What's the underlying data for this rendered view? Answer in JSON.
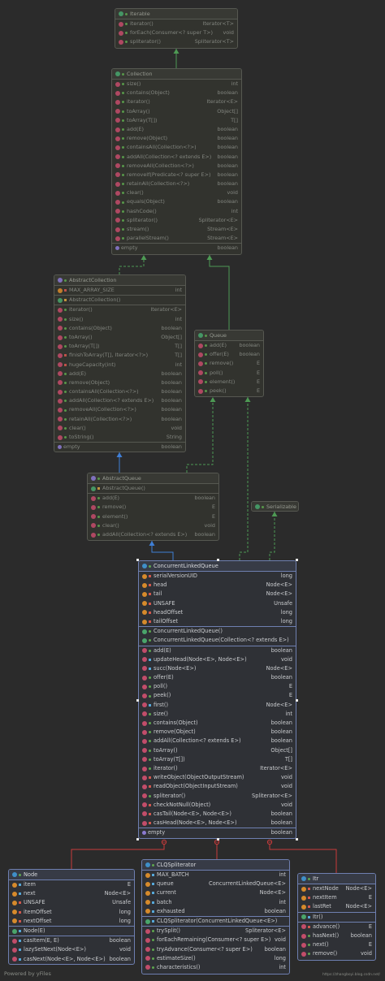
{
  "classes": [
    {
      "id": "Iterable",
      "kind": "interface",
      "title": "Iterable",
      "sections": [
        [
          {
            "icon": "m",
            "vis": "pub",
            "name": "iterator()",
            "type": "Iterator<T>"
          },
          {
            "icon": "m",
            "vis": "pub",
            "name": "forEach(Consumer<? super T>)",
            "type": "void"
          },
          {
            "icon": "m",
            "vis": "pub",
            "name": "spliterator()",
            "type": "Spliterator<T>"
          }
        ]
      ]
    },
    {
      "id": "Collection",
      "kind": "interface",
      "title": "Collection",
      "sections": [
        [
          {
            "icon": "m",
            "vis": "pub",
            "name": "size()",
            "type": "int"
          },
          {
            "icon": "m",
            "vis": "pub",
            "name": "contains(Object)",
            "type": "boolean"
          },
          {
            "icon": "m",
            "vis": "pub",
            "name": "iterator()",
            "type": "Iterator<E>"
          },
          {
            "icon": "m",
            "vis": "pub",
            "name": "toArray()",
            "type": "Object[]"
          },
          {
            "icon": "m",
            "vis": "pub",
            "name": "toArray(T[])",
            "type": "T[]"
          },
          {
            "icon": "m",
            "vis": "pub",
            "name": "add(E)",
            "type": "boolean"
          },
          {
            "icon": "m",
            "vis": "pub",
            "name": "remove(Object)",
            "type": "boolean"
          },
          {
            "icon": "m",
            "vis": "pub",
            "name": "containsAll(Collection<?>)",
            "type": "boolean"
          },
          {
            "icon": "m",
            "vis": "pub",
            "name": "addAll(Collection<? extends E>)",
            "type": "boolean"
          },
          {
            "icon": "m",
            "vis": "pub",
            "name": "removeAll(Collection<?>)",
            "type": "boolean"
          },
          {
            "icon": "m",
            "vis": "pub",
            "name": "removeIf(Predicate<? super E>)",
            "type": "boolean"
          },
          {
            "icon": "m",
            "vis": "pub",
            "name": "retainAll(Collection<?>)",
            "type": "boolean"
          },
          {
            "icon": "m",
            "vis": "pub",
            "name": "clear()",
            "type": "void"
          },
          {
            "icon": "m",
            "vis": "pub",
            "name": "equals(Object)",
            "type": "boolean"
          },
          {
            "icon": "m",
            "vis": "pub",
            "name": "hashCode()",
            "type": "int"
          },
          {
            "icon": "m",
            "vis": "pub",
            "name": "spliterator()",
            "type": "Spliterator<E>"
          },
          {
            "icon": "m",
            "vis": "pub",
            "name": "stream()",
            "type": "Stream<E>"
          },
          {
            "icon": "m",
            "vis": "pub",
            "name": "parallelStream()",
            "type": "Stream<E>"
          }
        ],
        [
          {
            "icon": "p",
            "vis": "",
            "name": "empty",
            "type": "boolean"
          }
        ]
      ]
    },
    {
      "id": "AbstractCollection",
      "kind": "abstract",
      "title": "AbstractCollection",
      "sections": [
        [
          {
            "icon": "f",
            "vis": "pri",
            "name": "MAX_ARRAY_SIZE",
            "type": "int"
          }
        ],
        [
          {
            "icon": "c",
            "vis": "pro",
            "name": "AbstractCollection()",
            "type": ""
          }
        ],
        [
          {
            "icon": "m",
            "vis": "pub",
            "name": "iterator()",
            "type": "Iterator<E>"
          },
          {
            "icon": "m",
            "vis": "pub",
            "name": "size()",
            "type": "int"
          },
          {
            "icon": "m",
            "vis": "pub",
            "name": "contains(Object)",
            "type": "boolean"
          },
          {
            "icon": "m",
            "vis": "pub",
            "name": "toArray()",
            "type": "Object[]"
          },
          {
            "icon": "m",
            "vis": "pub",
            "name": "toArray(T[])",
            "type": "T[]"
          },
          {
            "icon": "m",
            "vis": "pri",
            "name": "finishToArray(T[], Iterator<?>)",
            "type": "T[]"
          },
          {
            "icon": "m",
            "vis": "pri",
            "name": "hugeCapacity(int)",
            "type": "int"
          },
          {
            "icon": "m",
            "vis": "pub",
            "name": "add(E)",
            "type": "boolean"
          },
          {
            "icon": "m",
            "vis": "pub",
            "name": "remove(Object)",
            "type": "boolean"
          },
          {
            "icon": "m",
            "vis": "pub",
            "name": "containsAll(Collection<?>)",
            "type": "boolean"
          },
          {
            "icon": "m",
            "vis": "pub",
            "name": "addAll(Collection<? extends E>)",
            "type": "boolean"
          },
          {
            "icon": "m",
            "vis": "pub",
            "name": "removeAll(Collection<?>)",
            "type": "boolean"
          },
          {
            "icon": "m",
            "vis": "pub",
            "name": "retainAll(Collection<?>)",
            "type": "boolean"
          },
          {
            "icon": "m",
            "vis": "pub",
            "name": "clear()",
            "type": "void"
          },
          {
            "icon": "m",
            "vis": "pub",
            "name": "toString()",
            "type": "String"
          }
        ],
        [
          {
            "icon": "p",
            "vis": "",
            "name": "empty",
            "type": "boolean"
          }
        ]
      ]
    },
    {
      "id": "Queue",
      "kind": "interface",
      "title": "Queue",
      "sections": [
        [
          {
            "icon": "m",
            "vis": "pub",
            "name": "add(E)",
            "type": "boolean"
          },
          {
            "icon": "m",
            "vis": "pub",
            "name": "offer(E)",
            "type": "boolean"
          },
          {
            "icon": "m",
            "vis": "pub",
            "name": "remove()",
            "type": "E"
          },
          {
            "icon": "m",
            "vis": "pub",
            "name": "poll()",
            "type": "E"
          },
          {
            "icon": "m",
            "vis": "pub",
            "name": "element()",
            "type": "E"
          },
          {
            "icon": "m",
            "vis": "pub",
            "name": "peek()",
            "type": "E"
          }
        ]
      ]
    },
    {
      "id": "AbstractQueue",
      "kind": "abstract",
      "title": "AbstractQueue",
      "sections": [
        [
          {
            "icon": "c",
            "vis": "pro",
            "name": "AbstractQueue()",
            "type": ""
          }
        ],
        [
          {
            "icon": "m",
            "vis": "pub",
            "name": "add(E)",
            "type": "boolean"
          },
          {
            "icon": "m",
            "vis": "pub",
            "name": "remove()",
            "type": "E"
          },
          {
            "icon": "m",
            "vis": "pub",
            "name": "element()",
            "type": "E"
          },
          {
            "icon": "m",
            "vis": "pub",
            "name": "clear()",
            "type": "void"
          },
          {
            "icon": "m",
            "vis": "pub",
            "name": "addAll(Collection<? extends E>)",
            "type": "boolean"
          }
        ]
      ]
    },
    {
      "id": "Serializable",
      "kind": "interface",
      "title": "Serializable",
      "sections": []
    },
    {
      "id": "ConcurrentLinkedQueue",
      "kind": "class",
      "title": "ConcurrentLinkedQueue",
      "sections": [
        [
          {
            "icon": "f",
            "vis": "pri",
            "name": "serialVersionUID",
            "type": "long"
          },
          {
            "icon": "f",
            "vis": "pri",
            "name": "head",
            "type": "Node<E>"
          },
          {
            "icon": "f",
            "vis": "pri",
            "name": "tail",
            "type": "Node<E>"
          },
          {
            "icon": "f",
            "vis": "pri",
            "name": "UNSAFE",
            "type": "Unsafe"
          },
          {
            "icon": "f",
            "vis": "pri",
            "name": "headOffset",
            "type": "long"
          },
          {
            "icon": "f",
            "vis": "pri",
            "name": "tailOffset",
            "type": "long"
          }
        ],
        [
          {
            "icon": "c",
            "vis": "pub",
            "name": "ConcurrentLinkedQueue()",
            "type": ""
          },
          {
            "icon": "c",
            "vis": "pub",
            "name": "ConcurrentLinkedQueue(Collection<? extends E>)",
            "type": ""
          }
        ],
        [
          {
            "icon": "m",
            "vis": "pub",
            "name": "add(E)",
            "type": "boolean"
          },
          {
            "icon": "m",
            "vis": "pkg",
            "name": "updateHead(Node<E>, Node<E>)",
            "type": "void"
          },
          {
            "icon": "m",
            "vis": "pkg",
            "name": "succ(Node<E>)",
            "type": "Node<E>"
          },
          {
            "icon": "m",
            "vis": "pub",
            "name": "offer(E)",
            "type": "boolean"
          },
          {
            "icon": "m",
            "vis": "pub",
            "name": "poll()",
            "type": "E"
          },
          {
            "icon": "m",
            "vis": "pub",
            "name": "peek()",
            "type": "E"
          },
          {
            "icon": "m",
            "vis": "pkg",
            "name": "first()",
            "type": "Node<E>"
          },
          {
            "icon": "m",
            "vis": "pub",
            "name": "size()",
            "type": "int"
          },
          {
            "icon": "m",
            "vis": "pub",
            "name": "contains(Object)",
            "type": "boolean"
          },
          {
            "icon": "m",
            "vis": "pub",
            "name": "remove(Object)",
            "type": "boolean"
          },
          {
            "icon": "m",
            "vis": "pub",
            "name": "addAll(Collection<? extends E>)",
            "type": "boolean"
          },
          {
            "icon": "m",
            "vis": "pub",
            "name": "toArray()",
            "type": "Object[]"
          },
          {
            "icon": "m",
            "vis": "pub",
            "name": "toArray(T[])",
            "type": "T[]"
          },
          {
            "icon": "m",
            "vis": "pub",
            "name": "iterator()",
            "type": "Iterator<E>"
          },
          {
            "icon": "m",
            "vis": "pri",
            "name": "writeObject(ObjectOutputStream)",
            "type": "void"
          },
          {
            "icon": "m",
            "vis": "pri",
            "name": "readObject(ObjectInputStream)",
            "type": "void"
          },
          {
            "icon": "m",
            "vis": "pub",
            "name": "spliterator()",
            "type": "Spliterator<E>"
          },
          {
            "icon": "m",
            "vis": "pri",
            "name": "checkNotNull(Object)",
            "type": "void"
          },
          {
            "icon": "m",
            "vis": "pri",
            "name": "casTail(Node<E>, Node<E>)",
            "type": "boolean"
          },
          {
            "icon": "m",
            "vis": "pri",
            "name": "casHead(Node<E>, Node<E>)",
            "type": "boolean"
          }
        ],
        [
          {
            "icon": "p",
            "vis": "",
            "name": "empty",
            "type": "boolean"
          }
        ]
      ]
    },
    {
      "id": "Node",
      "kind": "class",
      "title": "Node",
      "sections": [
        [
          {
            "icon": "f",
            "vis": "pkg",
            "name": "item",
            "type": "E"
          },
          {
            "icon": "f",
            "vis": "pkg",
            "name": "next",
            "type": "Node<E>"
          },
          {
            "icon": "f",
            "vis": "pri",
            "name": "UNSAFE",
            "type": "Unsafe"
          },
          {
            "icon": "f",
            "vis": "pri",
            "name": "itemOffset",
            "type": "long"
          },
          {
            "icon": "f",
            "vis": "pri",
            "name": "nextOffset",
            "type": "long"
          }
        ],
        [
          {
            "icon": "c",
            "vis": "pkg",
            "name": "Node(E)",
            "type": ""
          }
        ],
        [
          {
            "icon": "m",
            "vis": "pkg",
            "name": "casItem(E, E)",
            "type": "boolean"
          },
          {
            "icon": "m",
            "vis": "pkg",
            "name": "lazySetNext(Node<E>)",
            "type": "void"
          },
          {
            "icon": "m",
            "vis": "pkg",
            "name": "casNext(Node<E>, Node<E>)",
            "type": "boolean"
          }
        ]
      ]
    },
    {
      "id": "CLQSpliterator",
      "kind": "class",
      "title": "CLQSpliterator",
      "sections": [
        [
          {
            "icon": "f",
            "vis": "pkg",
            "name": "MAX_BATCH",
            "type": "int"
          },
          {
            "icon": "f",
            "vis": "pkg",
            "name": "queue",
            "type": "ConcurrentLinkedQueue<E>"
          },
          {
            "icon": "f",
            "vis": "pkg",
            "name": "current",
            "type": "Node<E>"
          },
          {
            "icon": "f",
            "vis": "pkg",
            "name": "batch",
            "type": "int"
          },
          {
            "icon": "f",
            "vis": "pkg",
            "name": "exhausted",
            "type": "boolean"
          }
        ],
        [
          {
            "icon": "c",
            "vis": "pkg",
            "name": "CLQSpliterator(ConcurrentLinkedQueue<E>)",
            "type": ""
          }
        ],
        [
          {
            "icon": "m",
            "vis": "pub",
            "name": "trySplit()",
            "type": "Spliterator<E>"
          },
          {
            "icon": "m",
            "vis": "pub",
            "name": "forEachRemaining(Consumer<? super E>)",
            "type": "void"
          },
          {
            "icon": "m",
            "vis": "pub",
            "name": "tryAdvance(Consumer<? super E>)",
            "type": "boolean"
          },
          {
            "icon": "m",
            "vis": "pub",
            "name": "estimateSize()",
            "type": "long"
          },
          {
            "icon": "m",
            "vis": "pub",
            "name": "characteristics()",
            "type": "int"
          }
        ]
      ]
    },
    {
      "id": "Itr",
      "kind": "class",
      "title": "Itr",
      "sections": [
        [
          {
            "icon": "f",
            "vis": "pri",
            "name": "nextNode",
            "type": "Node<E>"
          },
          {
            "icon": "f",
            "vis": "pri",
            "name": "nextItem",
            "type": "E"
          },
          {
            "icon": "f",
            "vis": "pri",
            "name": "lastRet",
            "type": "Node<E>"
          }
        ],
        [
          {
            "icon": "c",
            "vis": "pkg",
            "name": "Itr()",
            "type": ""
          }
        ],
        [
          {
            "icon": "m",
            "vis": "pri",
            "name": "advance()",
            "type": "E"
          },
          {
            "icon": "m",
            "vis": "pub",
            "name": "hasNext()",
            "type": "boolean"
          },
          {
            "icon": "m",
            "vis": "pub",
            "name": "next()",
            "type": "E"
          },
          {
            "icon": "m",
            "vis": "pub",
            "name": "remove()",
            "type": "void"
          }
        ]
      ]
    }
  ],
  "relations": [
    {
      "from": "Collection",
      "to": "Iterable",
      "kind": "extends",
      "color": "#4e9a54"
    },
    {
      "from": "AbstractCollection",
      "to": "Collection",
      "kind": "implements",
      "color": "#4e9a54"
    },
    {
      "from": "Queue",
      "to": "Collection",
      "kind": "extends",
      "color": "#4e9a54"
    },
    {
      "from": "AbstractQueue",
      "to": "AbstractCollection",
      "kind": "extends",
      "color": "#3f7fd6"
    },
    {
      "from": "AbstractQueue",
      "to": "Queue",
      "kind": "implements",
      "color": "#4e9a54"
    },
    {
      "from": "ConcurrentLinkedQueue",
      "to": "AbstractQueue",
      "kind": "extends",
      "color": "#3f7fd6"
    },
    {
      "from": "ConcurrentLinkedQueue",
      "to": "Queue",
      "kind": "implements",
      "color": "#4e9a54"
    },
    {
      "from": "ConcurrentLinkedQueue",
      "to": "Serializable",
      "kind": "implements",
      "color": "#4e9a54"
    },
    {
      "from": "Node",
      "to": "ConcurrentLinkedQueue",
      "kind": "inner",
      "color": "#c93b3b"
    },
    {
      "from": "CLQSpliterator",
      "to": "ConcurrentLinkedQueue",
      "kind": "inner",
      "color": "#c93b3b"
    },
    {
      "from": "Itr",
      "to": "ConcurrentLinkedQueue",
      "kind": "inner",
      "color": "#c93b3b"
    }
  ],
  "footer": {
    "left": "Powered by yFiles",
    "right": "https://zhangboyi.blog.csdn.net/"
  }
}
